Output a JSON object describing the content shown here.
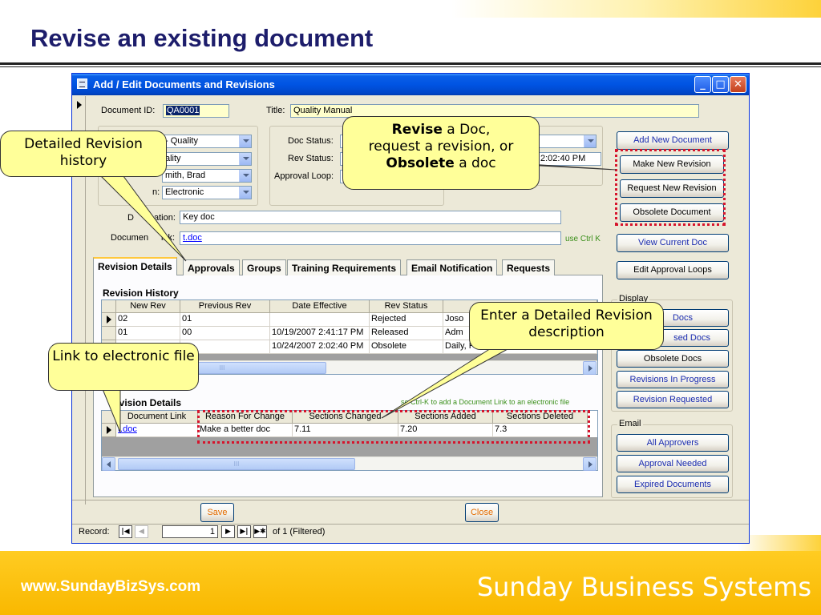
{
  "slide": {
    "title": "Revise an existing document",
    "footer_url": "www.SundayBizSys.com",
    "footer_brand": "Sunday Business Systems"
  },
  "window": {
    "title": "Add / Edit Documents and Revisions",
    "controls": {
      "minimize": "_",
      "maximize": "□",
      "close": "✕"
    }
  },
  "form": {
    "document_id_label": "Document ID:",
    "document_id": "QA0001",
    "title_label": "Title:",
    "title": "Quality Manual",
    "combo1": "- Quality",
    "combo2": "ality",
    "combo3_label_tail": "n:",
    "combo3": "mith, Brad",
    "combo4_label_tail": "n:",
    "combo4": "Electronic",
    "doc_status_label": "Doc Status:",
    "rev_status_label": "Rev Status:",
    "approval_loop_label": "Approval Loop:",
    "right_time": "2:02:40 PM",
    "description_label_tail": "ation:",
    "description_label_head": "D",
    "description": "Key doc",
    "doc_link_label_head": "Documen",
    "doc_link_label_tail": "ink:",
    "doc_link": "t.doc",
    "use_ctrl_k": "use Ctrl K"
  },
  "side_buttons": {
    "add_new": "Add New Document",
    "make_new_revision": "Make New Revision",
    "request_new_revision": "Request New Revision",
    "obsolete_document": "Obsolete Document",
    "view_current_doc": "View Current Doc",
    "edit_approval_loops": "Edit Approval Loops"
  },
  "display_group": {
    "label": "Display",
    "b1": "Docs",
    "b2": "sed Docs",
    "b3": "Obsolete Docs",
    "b4": "Revisions In Progress",
    "b5": "Revision Requested"
  },
  "email_group": {
    "label": "Email",
    "b1": "All Approvers",
    "b2": "Approval Needed",
    "b3": "Expired Documents"
  },
  "tabs": [
    "Revision Details",
    "Approvals",
    "Groups",
    "Training Requirements",
    "Email Notification",
    "Requests"
  ],
  "revision_history": {
    "heading": "Revision History",
    "columns": [
      "New Rev",
      "Previous Rev",
      "Date Effective",
      "Rev Status",
      "R"
    ],
    "rows": [
      [
        "02",
        "01",
        "",
        "Rejected",
        "Joso"
      ],
      [
        "01",
        "00",
        "10/19/2007 2:41:17 PM",
        "Released",
        "Adm"
      ],
      [
        "",
        "",
        "10/24/2007 2:02:40 PM",
        "Obsolete",
        "Daily, Fred"
      ]
    ],
    "scroll_grip": "III"
  },
  "revision_details": {
    "heading_tail": "evision Details",
    "ctrl_k_note": "se Ctrl-K to add a Document Link to an electronic file",
    "columns": [
      "Document Link",
      "Reason For Change",
      "Sections Changed",
      "Sections Added",
      "Sections Deleted"
    ],
    "row": [
      "t.doc",
      "Make a better doc",
      "7.11",
      "7.20",
      "7.3"
    ],
    "scroll_grip": "III"
  },
  "bottom": {
    "save": "Save",
    "close": "Close",
    "record_label": "Record:",
    "record_num": "1",
    "record_of": "of  1 (Filtered)",
    "nav": {
      "first": "|◀",
      "prev": "◀",
      "next": "▶",
      "last": "▶|",
      "new": "▶✱"
    }
  },
  "callouts": {
    "detailed_revision": "Detailed Revision history",
    "revise_bold": "Revise",
    "revise_rest1": " a Doc,",
    "revise_line2": "request a revision, or",
    "obsolete_bold": "Obsolete",
    "obsolete_rest": " a doc",
    "enter_detailed": "Enter a Detailed Revision description",
    "link_electronic": "Link to electronic file"
  },
  "colors": {
    "title_blue": "#1d1d6b",
    "footer_yellow": "#f9b800",
    "callout_fill": "#ffff99",
    "highlight_red": "#d6142c",
    "xp_title_blue": "#0054e3"
  }
}
